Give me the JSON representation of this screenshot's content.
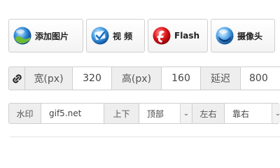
{
  "toolbar": {
    "buttons": [
      {
        "label": "添加图片",
        "icon": "blue-globe-icon"
      },
      {
        "label": "视 频",
        "icon": "video-check-icon"
      },
      {
        "label": "Flash",
        "icon": "flash-icon"
      },
      {
        "label": "摄像头",
        "icon": "webcam-icon"
      }
    ]
  },
  "size_row": {
    "link_icon": "link-icon",
    "width_label": "宽(px)",
    "width_value": "320",
    "height_label": "高(px)",
    "height_value": "160",
    "delay_label": "延迟",
    "delay_value": "800"
  },
  "watermark_row": {
    "watermark_label": "水印",
    "watermark_value": "gif5.net",
    "vertical_label": "上下",
    "vertical_selected": "顶部",
    "horizontal_label": "左右",
    "horizontal_selected": "靠右"
  },
  "colors": {
    "addon_bg": "#eeeeee",
    "border": "#cfcfcf",
    "text": "#555555"
  }
}
